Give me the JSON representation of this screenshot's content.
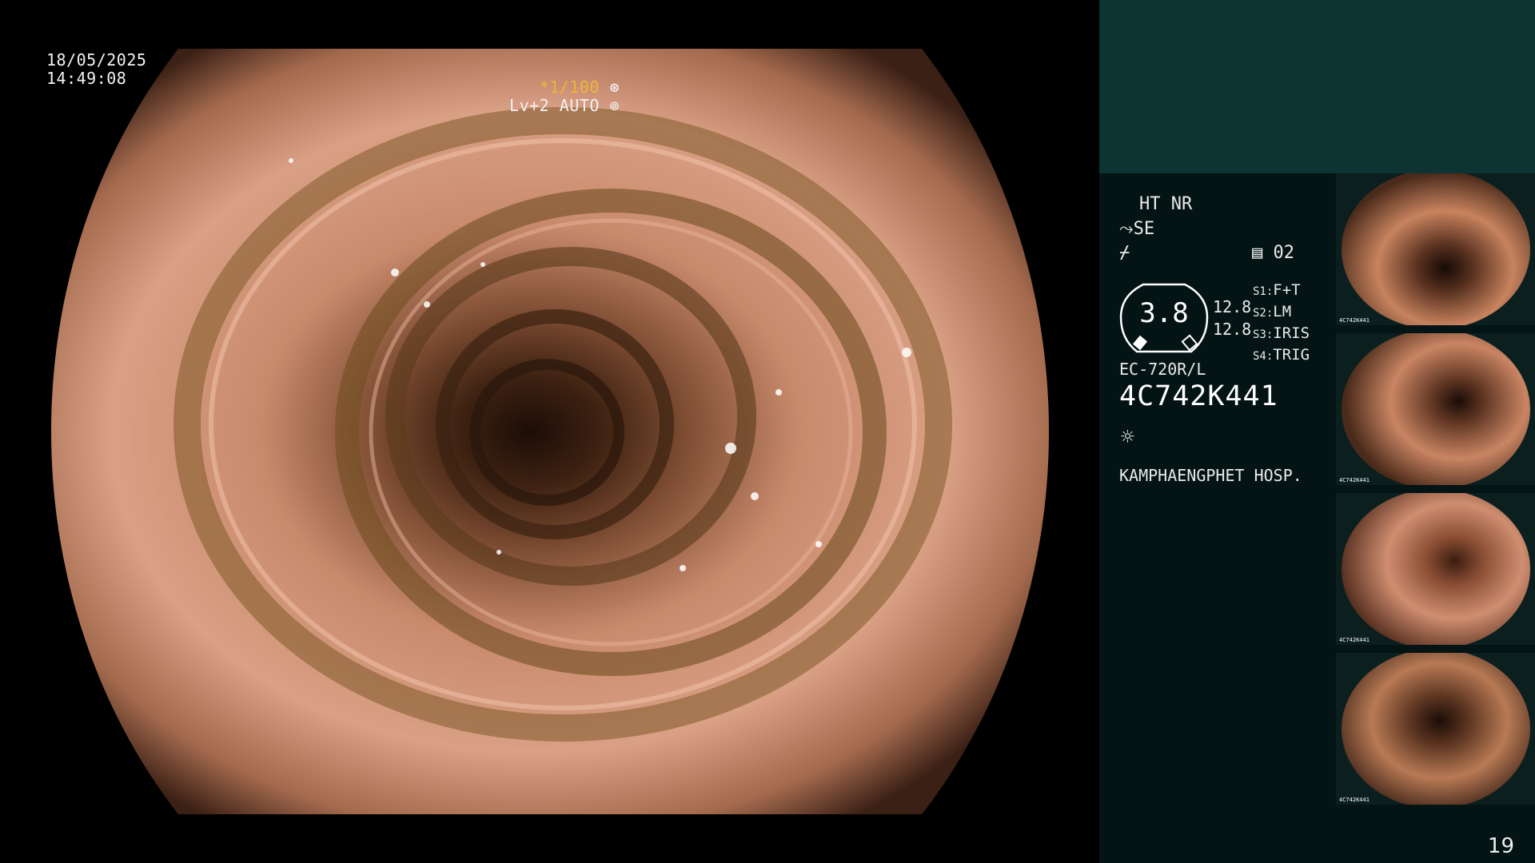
{
  "osd": {
    "date": "18/05/2025",
    "time": "14:49:08",
    "shutter": "*1/100",
    "level": "Lv+2 AUTO"
  },
  "panel": {
    "mode": "HT NR",
    "enhance": "SE",
    "memory": "02",
    "gauge_value": "3.8",
    "value_a": "12.8",
    "value_b": "12.8",
    "switches": [
      {
        "key": "S1:",
        "value": "F+T"
      },
      {
        "key": "S2:",
        "value": "LM"
      },
      {
        "key": "S3:",
        "value": "IRIS"
      },
      {
        "key": "S4:",
        "value": "TRIG"
      }
    ],
    "scope_model": "EC-720R/L",
    "scope_id": "4C742K441",
    "hospital": "KAMPHAENGPHET HOSP."
  },
  "thumbnails": [
    {
      "label": "4C742K441"
    },
    {
      "label": "4C742K441"
    },
    {
      "label": "4C742K441"
    },
    {
      "label": "4C742K441"
    }
  ],
  "page_number": "19",
  "colors": {
    "accent": "#f0b43c",
    "panel_top": "#0d3333",
    "panel": "#041313"
  },
  "icons": [
    "aperture-icon",
    "shutter-icon",
    "brightness-icon",
    "enhance-icon",
    "flash-icon",
    "memory-icon"
  ]
}
